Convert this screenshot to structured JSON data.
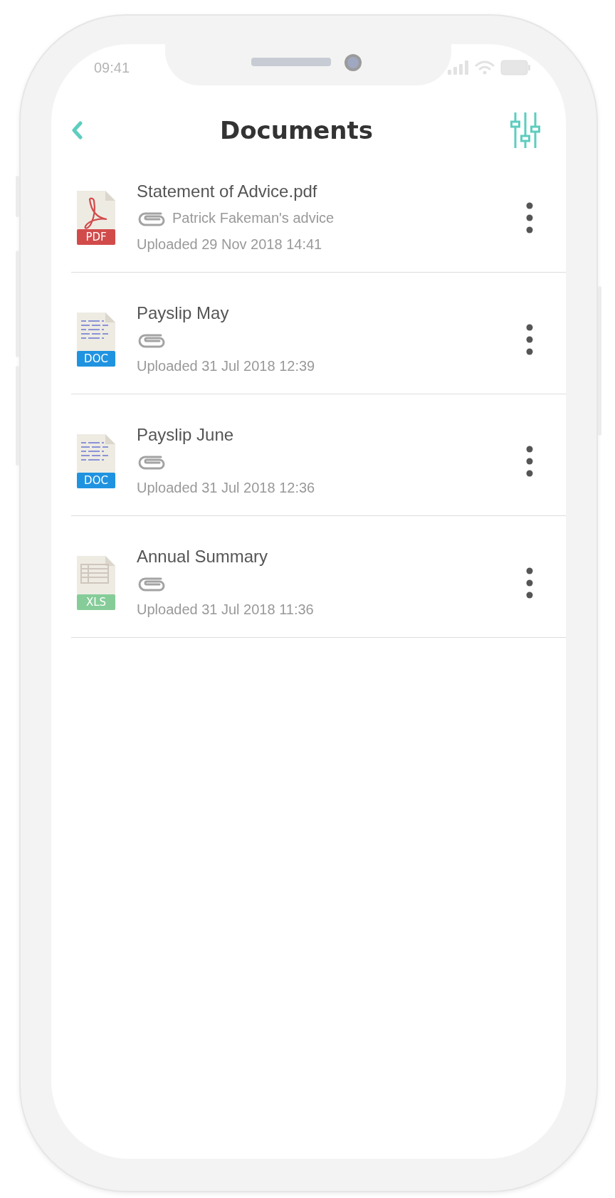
{
  "status_bar": {
    "time": "09:41"
  },
  "header": {
    "title": "Documents"
  },
  "documents": [
    {
      "kind": "pdf",
      "type_label": "PDF",
      "name": "Statement of Advice.pdf",
      "attachment_note": "Patrick Fakeman's advice",
      "uploaded": "Uploaded 29 Nov 2018 14:41"
    },
    {
      "kind": "doc",
      "type_label": "DOC",
      "name": "Payslip May",
      "uploaded": "Uploaded 31 Jul 2018 12:39"
    },
    {
      "kind": "doc",
      "type_label": "DOC",
      "name": "Payslip June",
      "uploaded": "Uploaded 31 Jul 2018 12:36"
    },
    {
      "kind": "xls",
      "type_label": "XLS",
      "name": "Annual Summary",
      "uploaded": "Uploaded 31 Jul 2018 11:36"
    }
  ]
}
